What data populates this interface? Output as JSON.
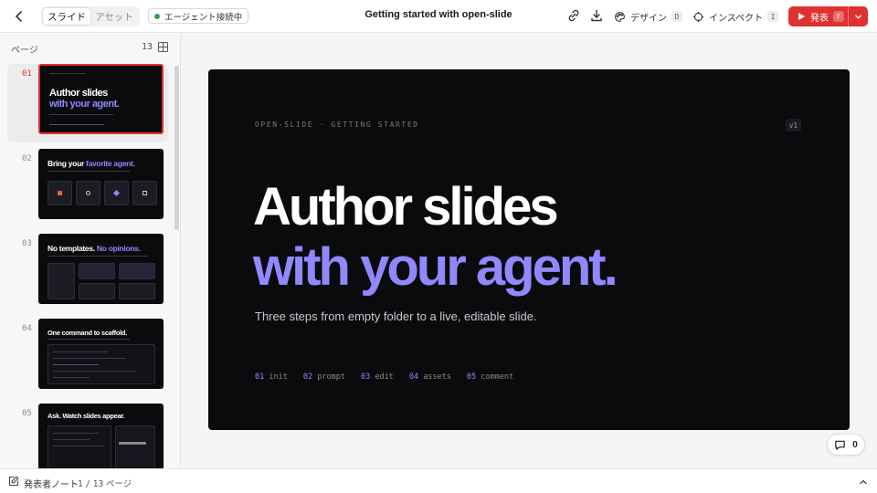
{
  "topbar": {
    "tabs": [
      {
        "label": "スライド",
        "active": true
      },
      {
        "label": "アセット",
        "active": false
      }
    ],
    "agent_status": "エージェント接続中",
    "doc_title": "Getting started with open-slide",
    "design_label": "デザイン",
    "design_key": "D",
    "inspect_label": "インスペクト",
    "inspect_key": "I",
    "present_label": "発表",
    "present_key": "F"
  },
  "sidebar": {
    "header": "ページ",
    "count": "13",
    "thumbnails": [
      {
        "num": "01",
        "active": true,
        "title_a": "Author slides",
        "title_b": "with your agent."
      },
      {
        "num": "02",
        "active": false,
        "title_a": "Bring your ",
        "title_b": "favorite agent."
      },
      {
        "num": "03",
        "active": false,
        "title_a": "No templates. ",
        "title_b": "No opinions."
      },
      {
        "num": "04",
        "active": false,
        "title_a": "One command to scaffold.",
        "title_b": ""
      },
      {
        "num": "05",
        "active": false,
        "title_a": "Ask. Watch slides appear.",
        "title_b": ""
      }
    ]
  },
  "slide": {
    "kicker": "OPEN-SLIDE · GETTING STARTED",
    "version": "v1",
    "title_line1": "Author slides",
    "title_line2": "with your agent.",
    "subtitle": "Three steps from empty folder to a live, editable slide.",
    "steps": [
      {
        "n": "01",
        "label": "init"
      },
      {
        "n": "02",
        "label": "prompt"
      },
      {
        "n": "03",
        "label": "edit"
      },
      {
        "n": "04",
        "label": "assets"
      },
      {
        "n": "05",
        "label": "comment"
      }
    ]
  },
  "comments": {
    "count": "0"
  },
  "bottombar": {
    "notes_label": "発表者ノート",
    "page_current": "1",
    "page_sep": "/",
    "page_total": "13",
    "page_suffix": "ページ"
  },
  "colors": {
    "accent": "#8f88ff",
    "present": "#e03131",
    "slide_bg": "#0b0b0d"
  }
}
